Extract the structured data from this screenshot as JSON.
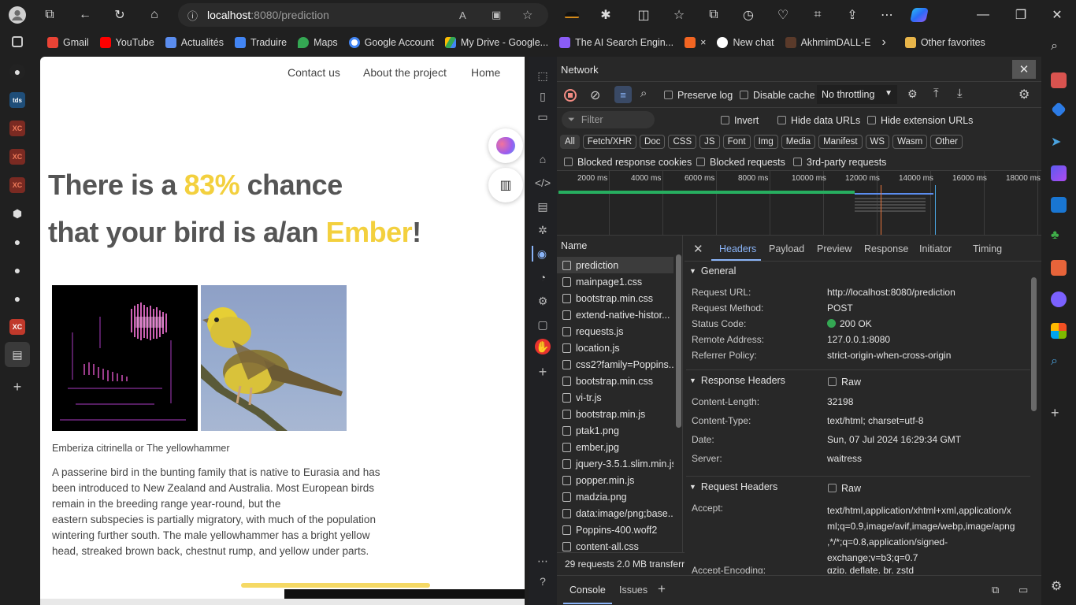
{
  "browser": {
    "url_host": "localhost",
    "url_path": ":8080/prediction",
    "bookmarks": [
      "Gmail",
      "YouTube",
      "Actualités",
      "Traduire",
      "Maps",
      "Google Account",
      "My Drive - Google...",
      "The AI Search Engin...",
      "×",
      "New chat",
      "AkhmimDALL-E"
    ],
    "other_favorites": "Other favorites",
    "left_tabs": [
      "tds",
      "XC",
      "XC",
      "XC",
      "XC"
    ],
    "colors": {
      "chrome_bg": "#202020",
      "accent_yellow": "#f3d03e"
    }
  },
  "page": {
    "nav": [
      "Contact us",
      "About the project",
      "Home"
    ],
    "hero_line1_pre": "There is a ",
    "hero_percent": "83%",
    "hero_line1_post": " chance",
    "hero_line2_pre": "that your bird is a/an ",
    "hero_bird": "Ember",
    "hero_line2_post": "!",
    "caption": "Emberiza citrinella or The yellowhammer",
    "description": [
      "A passerine bird in the bunting family that is native to Eurasia and has",
      "been introduced to New Zealand and Australia. Most European birds",
      "remain in the breeding range year-round, but the",
      "eastern subspecies is partially migratory, with much of the population",
      "wintering further south. The male yellowhammer has a bright yellow",
      "head, streaked brown back, chestnut rump, and yellow under parts."
    ]
  },
  "devtools": {
    "panel_title": "Network",
    "preserve_log": "Preserve log",
    "disable_cache": "Disable cache",
    "throttling": "No throttling",
    "filter_placeholder": "Filter",
    "invert": "Invert",
    "hide_data_urls": "Hide data URLs",
    "hide_extension_urls": "Hide extension URLs",
    "type_filters": [
      "All",
      "Fetch/XHR",
      "Doc",
      "CSS",
      "JS",
      "Font",
      "Img",
      "Media",
      "Manifest",
      "WS",
      "Wasm",
      "Other"
    ],
    "blocked_cookies": "Blocked response cookies",
    "blocked_requests": "Blocked requests",
    "third_party": "3rd-party requests",
    "timeline_ticks": [
      "2000 ms",
      "4000 ms",
      "6000 ms",
      "8000 ms",
      "10000 ms",
      "12000 ms",
      "14000 ms",
      "16000 ms",
      "18000 ms"
    ],
    "name_header": "Name",
    "requests": [
      "prediction",
      "mainpage1.css",
      "bootstrap.min.css",
      "extend-native-histor...",
      "requests.js",
      "location.js",
      "css2?family=Poppins...",
      "bootstrap.min.css",
      "vi-tr.js",
      "bootstrap.min.js",
      "ptak1.png",
      "ember.jpg",
      "jquery-3.5.1.slim.min.js",
      "popper.min.js",
      "madzia.png",
      "data:image/png;base...",
      "Poppins-400.woff2",
      "content-all.css"
    ],
    "summary": "29 requests   2.0 MB transferr",
    "detail_tabs": [
      "Headers",
      "Payload",
      "Preview",
      "Response",
      "Initiator",
      "Timing"
    ],
    "general_title": "General",
    "general": [
      {
        "k": "Request URL:",
        "v": "http://localhost:8080/prediction"
      },
      {
        "k": "Request Method:",
        "v": "POST"
      },
      {
        "k": "Status Code:",
        "v": "200 OK"
      },
      {
        "k": "Remote Address:",
        "v": "127.0.0.1:8080"
      },
      {
        "k": "Referrer Policy:",
        "v": "strict-origin-when-cross-origin"
      }
    ],
    "response_headers_title": "Response Headers",
    "raw": "Raw",
    "response_headers": [
      {
        "k": "Content-Length:",
        "v": "32198"
      },
      {
        "k": "Content-Type:",
        "v": "text/html; charset=utf-8"
      },
      {
        "k": "Date:",
        "v": "Sun, 07 Jul 2024 16:29:34 GMT"
      },
      {
        "k": "Server:",
        "v": "waitress"
      }
    ],
    "request_headers_title": "Request Headers",
    "accept_key": "Accept:",
    "accept_lines": [
      "text/html,application/xhtml+xml,application/x",
      "ml;q=0.9,image/avif,image/webp,image/apng",
      ",*/*;q=0.8,application/signed-",
      "exchange;v=b3;q=0.7"
    ],
    "accept_encoding_key": "Accept-Encoding:",
    "accept_encoding_val": "gzip, deflate, br, zstd",
    "drawer_tabs": [
      "Console",
      "Issues"
    ]
  }
}
